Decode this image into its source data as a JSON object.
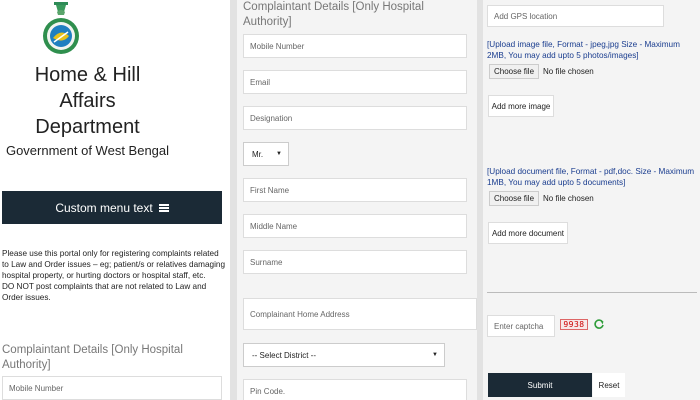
{
  "branding": {
    "department_lines": [
      "Home & Hill",
      "Affairs",
      "Department"
    ],
    "government": "Government of West Bengal"
  },
  "menu": {
    "label": "Custom menu text",
    "icon": "hamburger-icon"
  },
  "notice": {
    "text": "Please use this portal only for registering complaints related to Law and Order issues – eg; patient/s or relatives damaging hospital property, or hurting doctors or hospital staff, etc.",
    "warning": "DO NOT post complaints that are not related to Law and Order issues."
  },
  "section_title": "Complaintant Details [Only Hospital Authority]",
  "form": {
    "mobile": "Mobile Number",
    "email": "Email",
    "designation": "Designation",
    "salutation": "Mr.",
    "first_name": "First Name",
    "middle_name": "Middle Name",
    "surname": "Surname",
    "address": "Complainant Home Address",
    "district": "-- Select District --",
    "pin": "Pin Code.",
    "gps": "Add GPS location"
  },
  "uploads": {
    "image_note": "[Upload image file, Format - jpeg,jpg Size - Maximum 2MB, You may add upto 5 photos/images]",
    "doc_note": "[Upload document file, Format - pdf,doc. Size - Maximum 1MB, You may add upto 5 documents]",
    "choose_file": "Choose file",
    "no_file": "No file chosen",
    "add_image": "Add more image",
    "add_document": "Add more document"
  },
  "captcha": {
    "placeholder": "Enter captcha",
    "code": "9938",
    "refresh_icon": "refresh-icon"
  },
  "actions": {
    "submit": "Submit",
    "reset": "Reset"
  },
  "colors": {
    "dark": "#1b2a36",
    "link_blue": "#1a3d8f",
    "background": "#e2e2e2"
  }
}
